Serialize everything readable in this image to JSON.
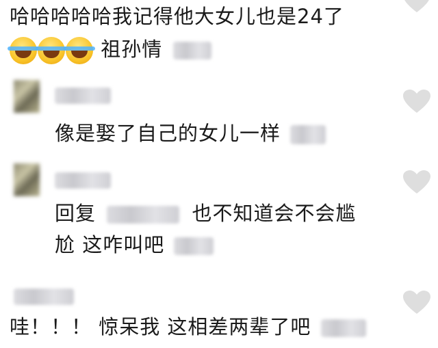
{
  "comments": [
    {
      "text": "哈哈哈哈哈我记得他大女儿也是24了",
      "line2": "祖孙情",
      "emoji": "laughing-crying-emoji"
    },
    {
      "text": "像是娶了自己的女儿一样"
    },
    {
      "reply_label": "回复",
      "text": "也不知道会不会尴",
      "line2": "尬 这咋叫吧"
    },
    {
      "text": "哇！！！ 惊呆我 这相差两辈了吧"
    }
  ],
  "colors": {
    "heart": "#dedede",
    "text": "#1a1a1a",
    "blur": "#d4d4d8"
  },
  "icons": {
    "like": "heart-icon"
  }
}
